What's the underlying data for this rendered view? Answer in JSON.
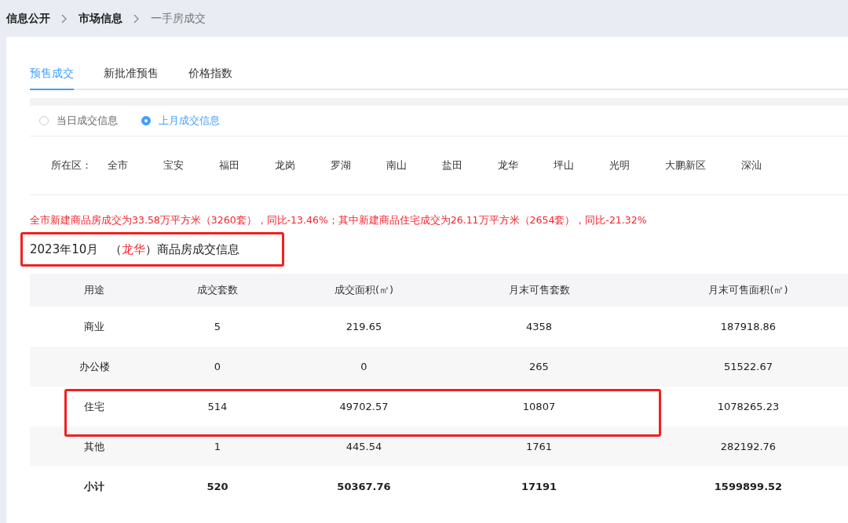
{
  "breadcrumb": [
    {
      "label": "信息公开",
      "current": false
    },
    {
      "label": "市场信息",
      "current": false
    },
    {
      "label": "一手房成交",
      "current": true
    }
  ],
  "tabs": [
    {
      "label": "预售成交",
      "selected": true
    },
    {
      "label": "新批准预售",
      "selected": false
    },
    {
      "label": "价格指数",
      "selected": false
    }
  ],
  "radios": [
    {
      "label": "当日成交信息",
      "selected": false
    },
    {
      "label": "上月成交信息",
      "selected": true
    }
  ],
  "district_filter": {
    "label": "所在区：",
    "options": [
      {
        "label": "全市",
        "selected": false
      },
      {
        "label": "宝安",
        "selected": false
      },
      {
        "label": "福田",
        "selected": false
      },
      {
        "label": "龙岗",
        "selected": false
      },
      {
        "label": "罗湖",
        "selected": false
      },
      {
        "label": "南山",
        "selected": false
      },
      {
        "label": "盐田",
        "selected": false
      },
      {
        "label": "龙华",
        "selected": false
      },
      {
        "label": "坪山",
        "selected": false
      },
      {
        "label": "光明",
        "selected": false
      },
      {
        "label": "大鹏新区",
        "selected": false
      },
      {
        "label": "深汕",
        "selected": false
      }
    ]
  },
  "summary": "全市新建商品房成交为33.58万平方米（3260套），同比-13.46%；其中新建商品住宅成交为26.11万平方米（2654套），同比-21.32%",
  "heading": {
    "month": "2023年10月",
    "district": "龙华",
    "suffix": "）商品房成交信息",
    "prefix": "（",
    "highlighted": true
  },
  "table": {
    "columns": [
      "用途",
      "成交套数",
      "成交面积(㎡)",
      "月末可售套数",
      "月末可售面积(㎡)"
    ],
    "rows": [
      {
        "cells": [
          "商业",
          "5",
          "219.65",
          "4358",
          "187918.86"
        ],
        "highlighted": false,
        "total": false
      },
      {
        "cells": [
          "办公楼",
          "0",
          "0",
          "265",
          "51522.67"
        ],
        "highlighted": false,
        "total": false
      },
      {
        "cells": [
          "住宅",
          "514",
          "49702.57",
          "10807",
          "1078265.23"
        ],
        "highlighted": true,
        "total": false
      },
      {
        "cells": [
          "其他",
          "1",
          "445.54",
          "1761",
          "282192.76"
        ],
        "highlighted": false,
        "total": false
      },
      {
        "cells": [
          "小计",
          "520",
          "50367.76",
          "17191",
          "1599899.52"
        ],
        "highlighted": false,
        "total": true
      }
    ]
  }
}
